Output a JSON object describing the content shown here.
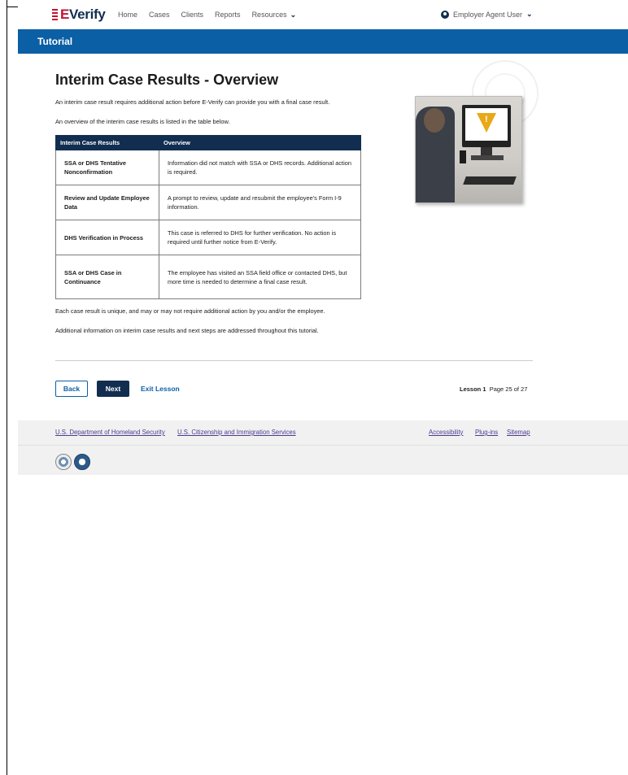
{
  "header": {
    "logo_e": "E",
    "logo_rest": "Verify",
    "nav": [
      {
        "label": "Home"
      },
      {
        "label": "Cases"
      },
      {
        "label": "Clients"
      },
      {
        "label": "Reports"
      },
      {
        "label": "Resources"
      }
    ],
    "user_label": "Employer Agent User"
  },
  "banner": {
    "title": "Tutorial"
  },
  "main": {
    "title": "Interim Case Results - Overview",
    "intro1": "An interim case result requires additional action before E-Verify can provide you with a final case result.",
    "intro2": "An overview of the interim case results is listed in the table below.",
    "table": {
      "headers": [
        "Interim Case Results",
        "Overview"
      ],
      "rows": [
        {
          "term": "SSA or DHS Tentative Nonconfirmation",
          "desc": "Information did not match with SSA or DHS records. Additional action is required."
        },
        {
          "term": "Review and Update Employee Data",
          "desc": "A prompt to review, update and resubmit the employee's Form I-9 information."
        },
        {
          "term": "DHS Verification in Process",
          "desc": "This case is referred to DHS for further verification. No action is required until further notice from E-Verify."
        },
        {
          "term": "SSA or DHS Case in Continuance",
          "desc": "The employee has visited an SSA field office or contacted DHS, but more time is needed to determine a final case result."
        }
      ]
    },
    "after1": "Each case result is unique, and may or may not require additional action by you and/or the employee.",
    "after2": "Additional information on interim case results and next steps are addressed throughout this tutorial."
  },
  "nav_buttons": {
    "back": "Back",
    "next": "Next",
    "exit": "Exit Lesson",
    "lesson_label": "Lesson 1",
    "page_label": "Page 25 of 27"
  },
  "footer": {
    "dhs": "U.S. Department of Homeland Security",
    "uscis": "U.S. Citizenship and Immigration Services",
    "accessibility": "Accessibility",
    "plugins": "Plug-ins",
    "sitemap": "Sitemap"
  },
  "colors": {
    "brand_blue": "#0b5fa5",
    "navy": "#112e51",
    "warning": "#e8a817"
  }
}
